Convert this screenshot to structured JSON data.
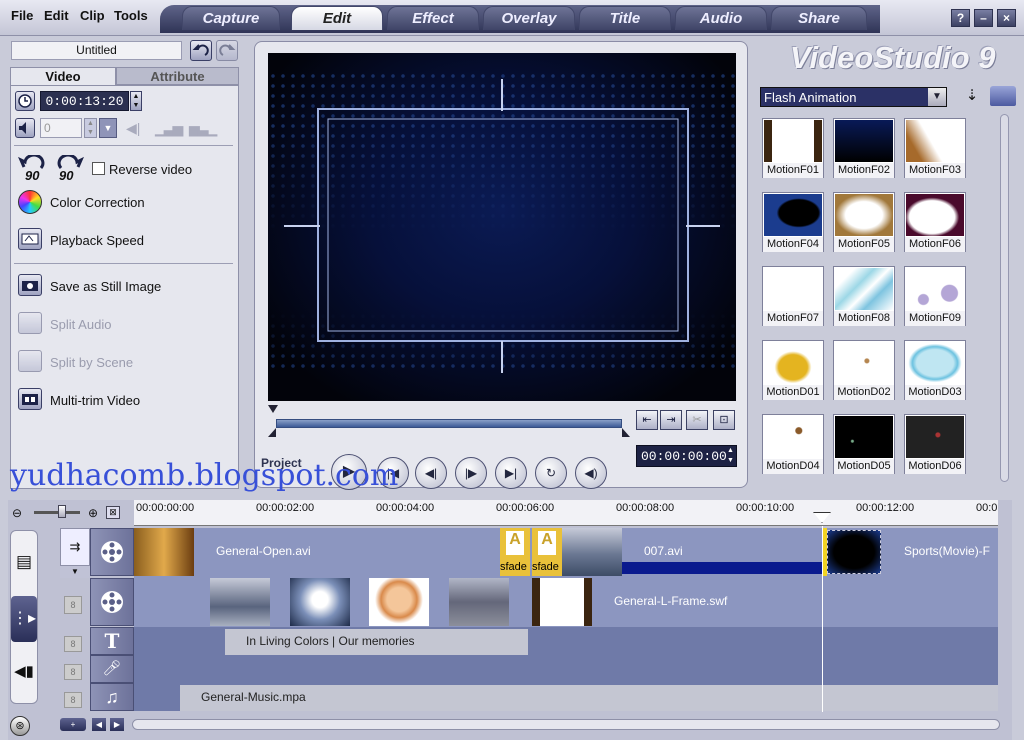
{
  "menu": {
    "file": "File",
    "edit": "Edit",
    "clip": "Clip",
    "tools": "Tools"
  },
  "steps": [
    "Capture",
    "Edit",
    "Effect",
    "Overlay",
    "Title",
    "Audio",
    "Share"
  ],
  "window_buttons": {
    "help": "?",
    "minimize": "–",
    "close": "×"
  },
  "brand": "VideoStudio 9",
  "project_name": "Untitled",
  "panel_tabs": {
    "video": "Video",
    "attribute": "Attribute"
  },
  "duration": "0:00:13:20",
  "volume": "0",
  "options": {
    "reverse": "Reverse video",
    "color_correction": "Color Correction",
    "playback_speed": "Playback Speed",
    "save_still": "Save as Still Image",
    "split_audio": "Split Audio",
    "split_scene": "Split by Scene",
    "multi_trim": "Multi-trim Video"
  },
  "rotate_label": "90",
  "preview": {
    "project_label": "Project",
    "timecode": "00:00:00:00"
  },
  "library": {
    "category": "Flash Animation",
    "items": [
      "MotionF01",
      "MotionF02",
      "MotionF03",
      "MotionF04",
      "MotionF05",
      "MotionF06",
      "MotionF07",
      "MotionF08",
      "MotionF09",
      "MotionD01",
      "MotionD02",
      "MotionD03",
      "MotionD04",
      "MotionD05",
      "MotionD06"
    ]
  },
  "ruler": [
    "00:00:00:00",
    "00:00:02:00",
    "00:00:04:00",
    "00:00:06:00",
    "00:00:08:00",
    "00:00:10:00",
    "00:00:12:00",
    "00:0"
  ],
  "tracks": {
    "video_clip1": "General-Open.avi",
    "transition1": "sfade",
    "transition2": "sfade",
    "video_clip2": "007.avi",
    "video_clip3": "Sports(Movie)-F",
    "overlay_clip": "General-L-Frame.swf",
    "title_clip": "In Living Colors | Our memories",
    "music_clip": "General-Music.mpa"
  },
  "track_slot_label": "8",
  "watermark": "yudhacomb.blogspot.com",
  "colors": {
    "accent": "#3c4166",
    "timeline_track": "#8c96c0",
    "watermark": "#3850d8"
  }
}
